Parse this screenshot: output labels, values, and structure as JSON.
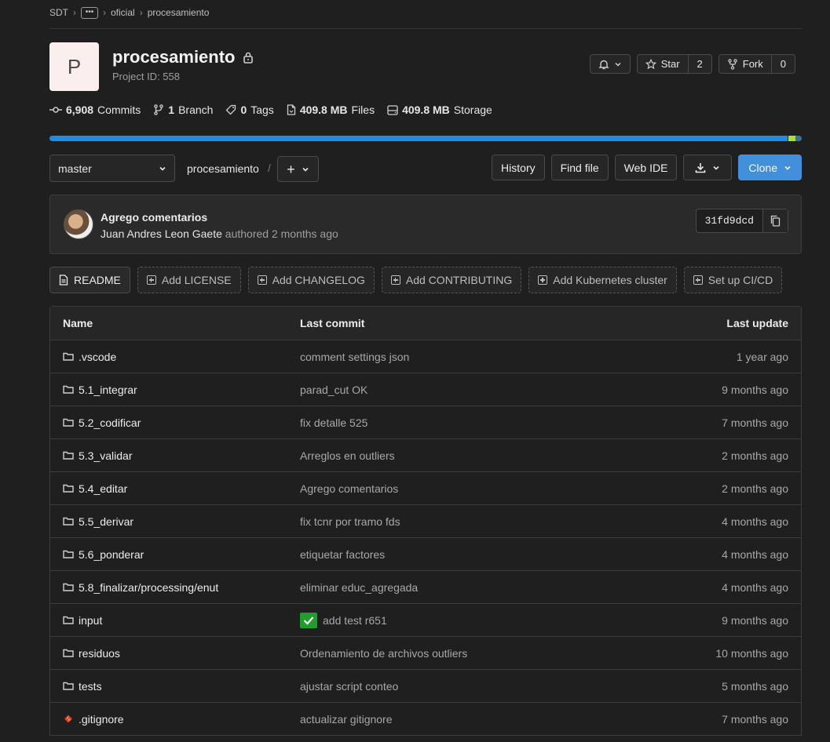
{
  "breadcrumb": {
    "root": "SDT",
    "ellipsis": "•••",
    "group": "oficial",
    "project": "procesamiento"
  },
  "project": {
    "avatar_letter": "P",
    "name": "procesamiento",
    "id_text": "Project ID: 558"
  },
  "header_buttons": {
    "star_label": "Star",
    "star_count": "2",
    "fork_label": "Fork",
    "fork_count": "0"
  },
  "stats": {
    "commits_count": "6,908",
    "commits_label": "Commits",
    "branch_count": "1",
    "branch_label": "Branch",
    "tags_count": "0",
    "tags_label": "Tags",
    "files_size": "409.8 MB",
    "files_label": "Files",
    "storage_size": "409.8 MB",
    "storage_label": "Storage"
  },
  "language_bar_colors": [
    "#1f8ce6",
    "#a6e22e",
    "#3b6fa3"
  ],
  "branch": {
    "selected": "master",
    "path": "procesamiento",
    "path_sep": "/",
    "add_symbol": "+"
  },
  "actions": {
    "history": "History",
    "find_file": "Find file",
    "web_ide": "Web IDE",
    "clone": "Clone"
  },
  "last_commit": {
    "message": "Agrego comentarios",
    "author": "Juan Andres Leon Gaete",
    "authored": "authored 2 months ago",
    "sha": "31fd9dcd"
  },
  "quick_actions": [
    "README",
    "Add LICENSE",
    "Add CHANGELOG",
    "Add CONTRIBUTING",
    "Add Kubernetes cluster",
    "Set up CI/CD"
  ],
  "table": {
    "headers": {
      "name": "Name",
      "last_commit": "Last commit",
      "last_update": "Last update"
    },
    "rows": [
      {
        "name": ".vscode",
        "type": "folder",
        "commit": "comment settings json",
        "update": "1 year ago"
      },
      {
        "name": "5.1_integrar",
        "type": "folder",
        "commit": "parad_cut OK",
        "update": "9 months ago"
      },
      {
        "name": "5.2_codificar",
        "type": "folder",
        "commit": "fix detalle 525",
        "update": "7 months ago"
      },
      {
        "name": "5.3_validar",
        "type": "folder",
        "commit": "Arreglos en outliers",
        "update": "2 months ago"
      },
      {
        "name": "5.4_editar",
        "type": "folder",
        "commit": "Agrego comentarios",
        "update": "2 months ago"
      },
      {
        "name": "5.5_derivar",
        "type": "folder",
        "commit": "fix tcnr por tramo fds",
        "update": "4 months ago"
      },
      {
        "name": "5.6_ponderar",
        "type": "folder",
        "commit": "etiquetar factores",
        "update": "4 months ago"
      },
      {
        "name": "5.8_finalizar/processing/enut",
        "type": "folder",
        "commit": "eliminar educ_agregada",
        "update": "4 months ago"
      },
      {
        "name": "input",
        "type": "folder",
        "commit": "add test r651",
        "update": "9 months ago",
        "commit_icon": "check-icon"
      },
      {
        "name": "residuos",
        "type": "folder",
        "commit": "Ordenamiento de archivos outliers",
        "update": "10 months ago"
      },
      {
        "name": "tests",
        "type": "folder",
        "commit": "ajustar script conteo",
        "update": "5 months ago"
      },
      {
        "name": ".gitignore",
        "type": "git-file",
        "commit": "actualizar gitignore",
        "update": "7 months ago"
      }
    ]
  }
}
